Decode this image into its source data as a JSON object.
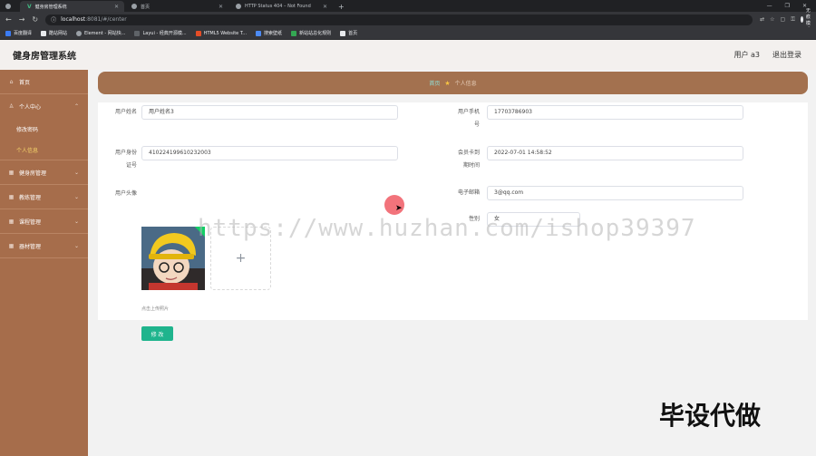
{
  "browser": {
    "tabs": [
      {
        "title": "健身房管理系统",
        "active": true
      },
      {
        "title": "首页",
        "active": false
      },
      {
        "title": "HTTP Status 404 – Not Found",
        "active": false
      }
    ],
    "url_host": "localhost",
    "url_path": ":8081/#/center",
    "profile": "无痕模式",
    "bookmarks": [
      "百度翻译",
      "酷站网站",
      "Element - 网站快...",
      "Layui - 经典开源模...",
      "HTML5 Website T...",
      "搜索壁纸",
      "新站站总化规则",
      "首页"
    ]
  },
  "app": {
    "title": "健身房管理系统",
    "user_label": "用户 a3",
    "logout_label": "退出登录"
  },
  "sidebar": {
    "items": [
      {
        "label": "首页",
        "icon": "home-icon"
      },
      {
        "label": "个人中心",
        "icon": "user-icon"
      },
      {
        "label": "健身房管理",
        "icon": "grid-icon"
      },
      {
        "label": "教练管理",
        "icon": "grid-icon"
      },
      {
        "label": "课程管理",
        "icon": "grid-icon"
      },
      {
        "label": "器材管理",
        "icon": "grid-icon"
      }
    ],
    "sub_items": [
      {
        "label": "修改密码",
        "active": false
      },
      {
        "label": "个人信息",
        "active": true
      }
    ]
  },
  "breadcrumb": {
    "home": "首页",
    "current": "个人信息"
  },
  "form": {
    "username_label": "用户姓名",
    "username_value": "用户姓名3",
    "phone_label_1": "用户手机",
    "phone_label_2": "号",
    "phone_value": "17703786903",
    "idcard_label_1": "用户身份",
    "idcard_label_2": "证号",
    "idcard_value": "410224199610232003",
    "expire_label_1": "会员卡到",
    "expire_label_2": "期时间",
    "expire_value": "2022-07-01 14:58:52",
    "avatar_label": "用户头像",
    "email_label": "电子邮箱",
    "email_value": "3@qq.com",
    "gender_label": "性别",
    "gender_value": "女",
    "upload_hint": "点击上传照片",
    "save_label": "修 改"
  },
  "overlay": {
    "watermark": "https://www.huzhan.com/ishop39397",
    "corner_text": "毕设代做"
  }
}
